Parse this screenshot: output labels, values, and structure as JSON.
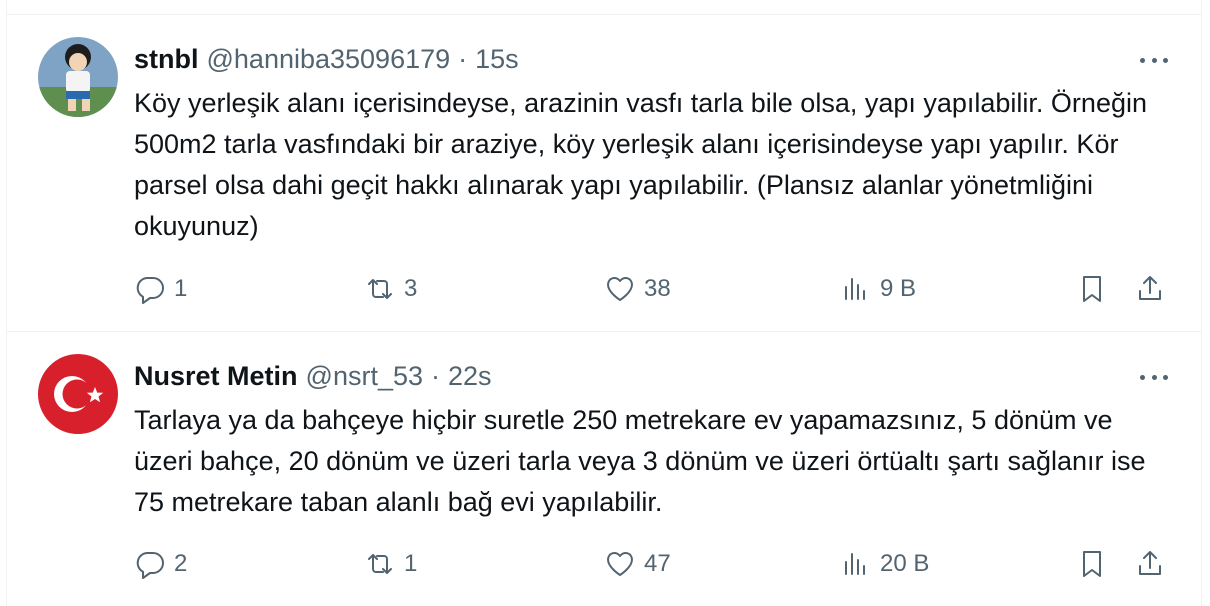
{
  "colors": {
    "text": "#0f1419",
    "secondary": "#536471",
    "divider": "#eff3f4"
  },
  "tweets": [
    {
      "name": "stnbl",
      "handle": "@hanniba35096179",
      "separator": "·",
      "time": "15s",
      "text": "Köy yerleşik alanı içerisindeyse, arazinin vasfı tarla bile olsa, yapı yapılabilir. Örneğin 500m2 tarla vasfındaki bir araziye, köy yerleşik alanı içerisindeyse yapı yapılır. Kör parsel olsa dahi geçit hakkı alınarak yapı yapılabilir. (Plansız alanlar yönetmliğini okuyunuz)",
      "replies": "1",
      "retweets": "3",
      "likes": "38",
      "views": "9 B",
      "avatar_icon": "cartoon-soccer-player-avatar"
    },
    {
      "name": "Nusret Metin",
      "handle": "@nsrt_53",
      "separator": "·",
      "time": "22s",
      "text": "Tarlaya ya da bahçeye hiçbir suretle 250 metrekare ev yapamazsınız, 5 dönüm ve üzeri bahçe, 20 dönüm ve üzeri tarla veya 3 dönüm ve üzeri örtüaltı şartı sağlanır ise 75 metrekare taban alanlı bağ evi yapılabilir.",
      "replies": "2",
      "retweets": "1",
      "likes": "47",
      "views": "20 B",
      "avatar_icon": "turkish-flag-avatar"
    }
  ]
}
